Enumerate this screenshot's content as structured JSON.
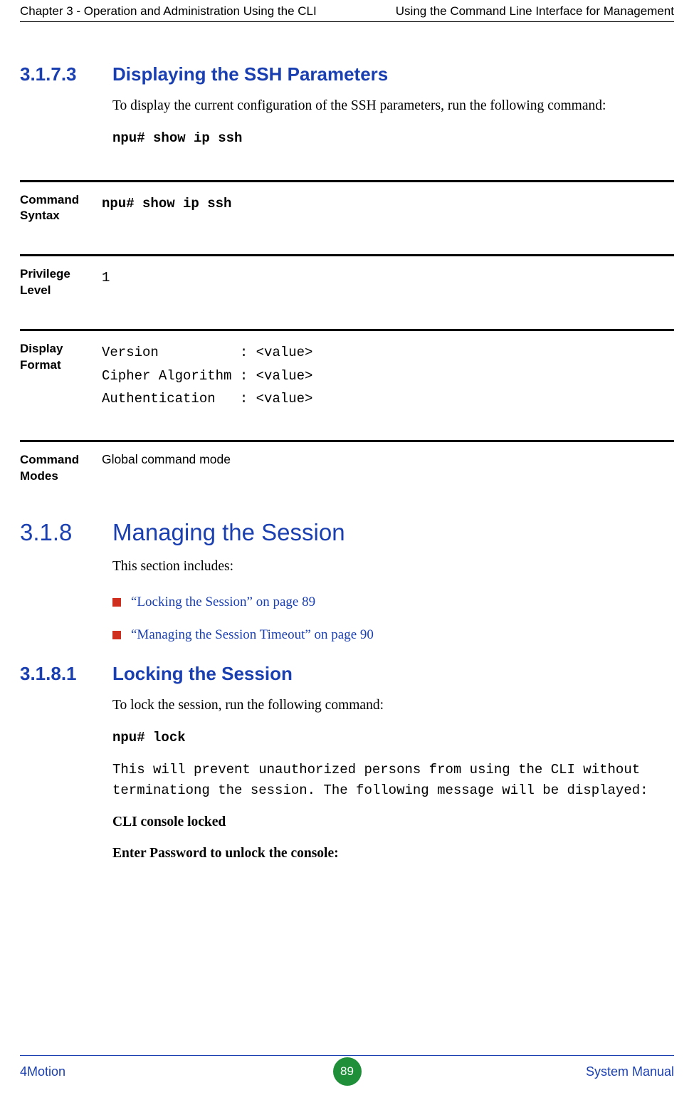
{
  "header": {
    "left": "Chapter 3 - Operation and Administration Using the CLI",
    "right": "Using the Command Line Interface for Management"
  },
  "sec31573": {
    "num": "3.1.7.3",
    "title": "Displaying the SSH Parameters",
    "intro": "To display the current configuration of the SSH parameters, run the following command:",
    "cmd": "npu# show ip ssh"
  },
  "blocks": {
    "syntax_label": "Command Syntax",
    "syntax_value": "npu# show ip ssh",
    "priv_label": "Privilege Level",
    "priv_value": "1",
    "disp_label": "Display Format",
    "disp_value": "Version          : <value>\nCipher Algorithm : <value>\nAuthentication   : <value>",
    "modes_label": "Command Modes",
    "modes_value": "Global command mode"
  },
  "sec318": {
    "num": "3.1.8",
    "title": "Managing the Session",
    "intro": "This section includes:",
    "bullet1": "“Locking the Session” on page 89",
    "bullet2": "“Managing the Session Timeout” on page 90"
  },
  "sec3181": {
    "num": "3.1.8.1",
    "title": "Locking the Session",
    "intro": "To lock the session, run the following command:",
    "cmd": "npu# lock",
    "desc": "This will prevent unauthorized persons from using the CLI without terminationg the session. The following message will be displayed:",
    "msg1": "CLI console locked",
    "msg2": "Enter Password to unlock the console:"
  },
  "footer": {
    "left": "4Motion",
    "page": "89",
    "right": "System Manual"
  }
}
